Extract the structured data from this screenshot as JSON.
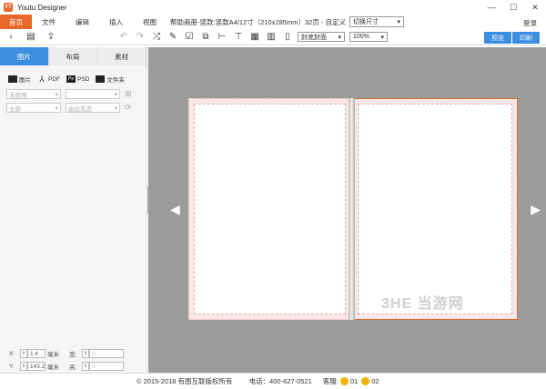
{
  "app": {
    "title": "Youtu Designer",
    "logo_text": "YT"
  },
  "window": {
    "minimize": "—",
    "maximize": "☐",
    "close": "✕"
  },
  "menu": {
    "items": [
      "首页",
      "文件",
      "编辑",
      "插入",
      "视图",
      "帮助"
    ],
    "doc_info": "画册-竖款:竖款A4/12寸（210x285mm）32页 - 自定义",
    "size_select": "切换尺寸",
    "login": "登录"
  },
  "toolbar": {
    "cover_select": "封底封面",
    "zoom_select": "100%",
    "preview": "预览",
    "print": "印刷"
  },
  "left_panel": {
    "tabs": [
      "图片",
      "布局",
      "素材"
    ],
    "file_types": [
      {
        "icon": "folder-icon",
        "label": "图片"
      },
      {
        "icon": "pdf-icon",
        "label": "PDF"
      },
      {
        "icon": "psd-icon",
        "label": "PSD"
      },
      {
        "icon": "folder-icon",
        "label": "文件夹"
      }
    ],
    "filter1": "未使用",
    "filter2": "",
    "filter3": "全部",
    "filter4": "由远及近",
    "coords": {
      "x_label": "X:",
      "x_value": "1.4",
      "x_unit": "毫米",
      "y_label": "Y:",
      "y_value": "143.2",
      "y_unit": "毫米",
      "w_label": "宽:",
      "w_value": "0",
      "h_label": "高:",
      "h_value": "0"
    }
  },
  "canvas": {
    "watermark": "3HE 当游网"
  },
  "footer": {
    "copyright": "© 2015-2018 有图互联版权所有",
    "phone": "电话：400-627-0521",
    "service_label": "客服:",
    "service_1": "01",
    "service_2": "02"
  },
  "colors": {
    "accent": "#e8682a",
    "primary_button": "#3b8ee0",
    "canvas_bg": "#9b9b9b"
  }
}
